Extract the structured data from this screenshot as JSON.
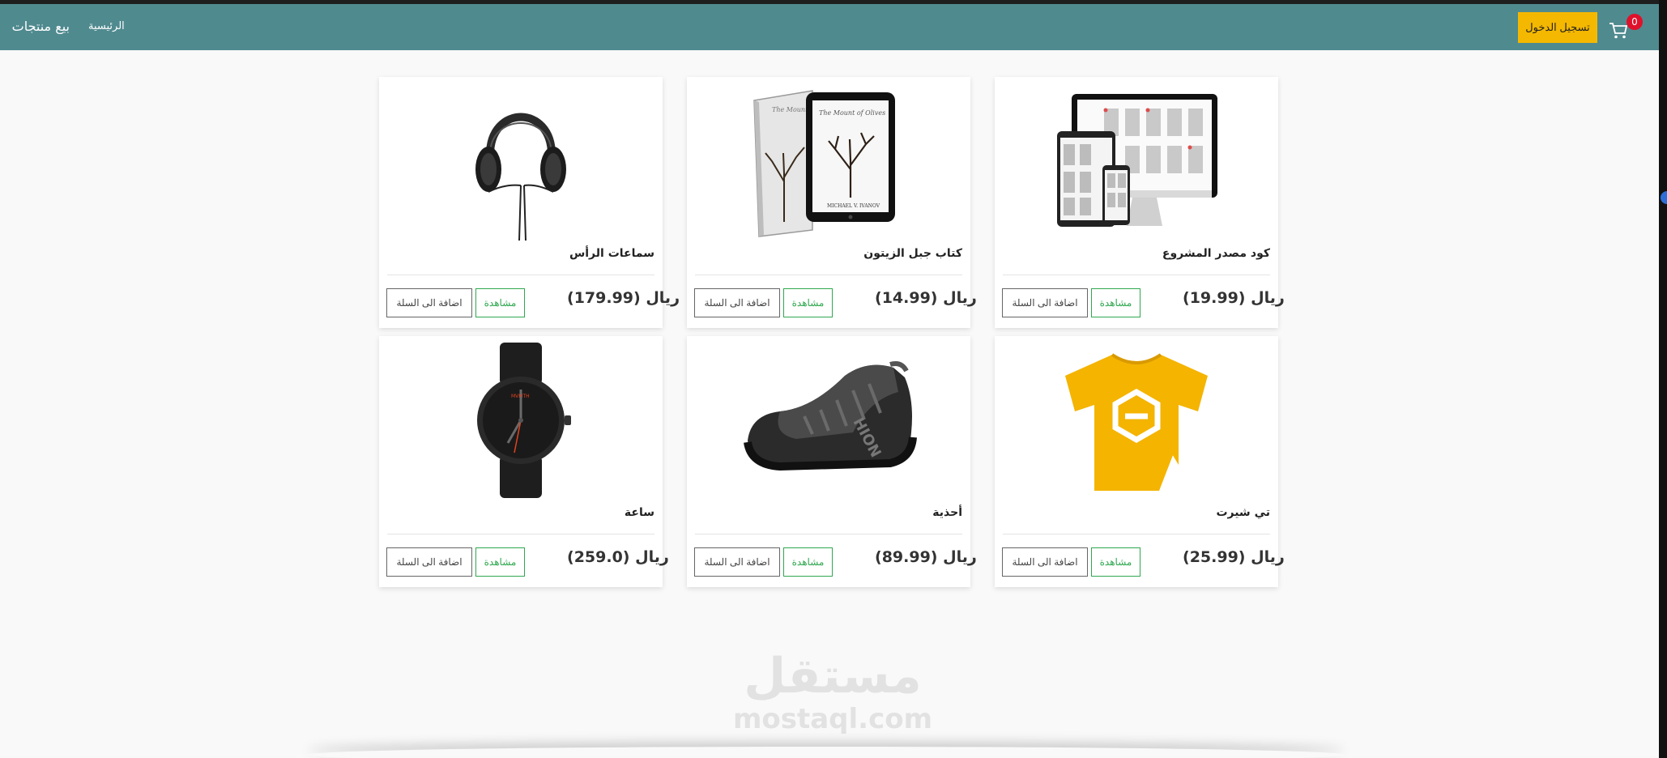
{
  "nav": {
    "brand": "بيع منتجات",
    "home": "الرئيسية",
    "login": "تسجيل الدخول",
    "cart_count": "0"
  },
  "buttons": {
    "view": "مشاهدة",
    "add": "اضافة الى السلة"
  },
  "products": [
    {
      "name": "كود مصدر المشروع",
      "price": "ريال (19.99)",
      "image_icon": "website-mockup-image"
    },
    {
      "name": "كتاب جبل الزيتون",
      "price": "ريال (14.99)",
      "image_icon": "book-tablet-image"
    },
    {
      "name": "سماعات الرأس",
      "price": "ريال (179.99)",
      "image_icon": "headphones-image"
    },
    {
      "name": "تي شيرت",
      "price": "ريال (25.99)",
      "image_icon": "tshirt-image"
    },
    {
      "name": "أحذية",
      "price": "ريال (89.99)",
      "image_icon": "shoe-image"
    },
    {
      "name": "ساعة",
      "price": "ريال (259.0)",
      "image_icon": "watch-image"
    }
  ],
  "watermark": {
    "arabic": "مستقل",
    "english": "mostaql.com"
  },
  "colors": {
    "navbar": "#4f8a8f",
    "login_button": "#f5b800",
    "view_button": "#2fa84f",
    "badge": "#e0112b"
  }
}
